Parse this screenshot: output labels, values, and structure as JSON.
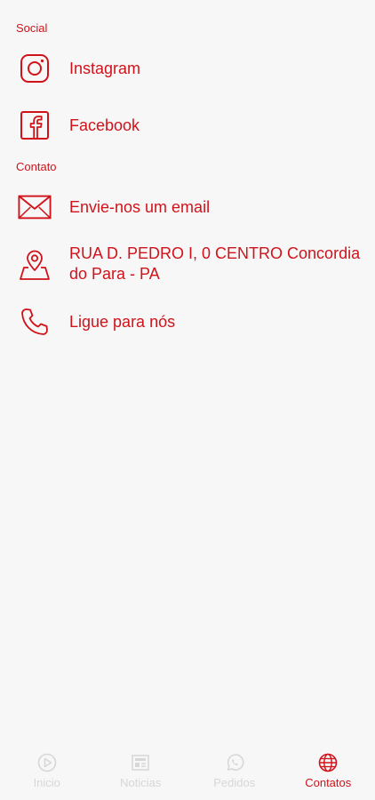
{
  "social": {
    "title": "Social",
    "instagram": "Instagram",
    "facebook": "Facebook"
  },
  "contact": {
    "title": "Contato",
    "email": "Envie-nos um email",
    "address_line1": "RUA D. PEDRO I, 0 CENTRO Concordia",
    "address_line2": "do Para - PA",
    "phone": "Ligue para nós"
  },
  "tabs": [
    {
      "label": "Inicio",
      "icon": "play-circle-icon"
    },
    {
      "label": "Noticias",
      "icon": "newspaper-icon"
    },
    {
      "label": "Pedidos",
      "icon": "whatsapp-icon"
    },
    {
      "label": "Contatos",
      "icon": "globe-icon",
      "active": true
    }
  ],
  "colors": {
    "accent": "#d0131b",
    "inactive": "#d7d7d7",
    "background": "#f7f7f7"
  }
}
